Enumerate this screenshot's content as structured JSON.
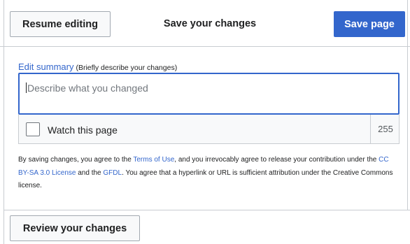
{
  "header": {
    "resume_label": "Resume editing",
    "title": "Save your changes",
    "save_label": "Save page"
  },
  "summary": {
    "label_link": "Edit summary",
    "label_hint": "(Briefly describe your changes)",
    "placeholder": "Describe what you changed",
    "value": ""
  },
  "watch": {
    "label": "Watch this page",
    "checked": false,
    "char_count": "255"
  },
  "license": {
    "t1": "By saving changes, you agree to the ",
    "terms_link": "Terms of Use",
    "t2": ", and you irrevocably agree to release your contribution under the ",
    "cc_link": "CC BY-SA 3.0 License",
    "t3": " and the ",
    "gfdl_link": "GFDL",
    "t4": ". You agree that a hyperlink or URL is sufficient attribution under the Creative Commons license."
  },
  "footer": {
    "review_label": "Review your changes"
  },
  "colors": {
    "primary": "#3366cc",
    "border": "#c8ccd1",
    "text": "#202122"
  }
}
